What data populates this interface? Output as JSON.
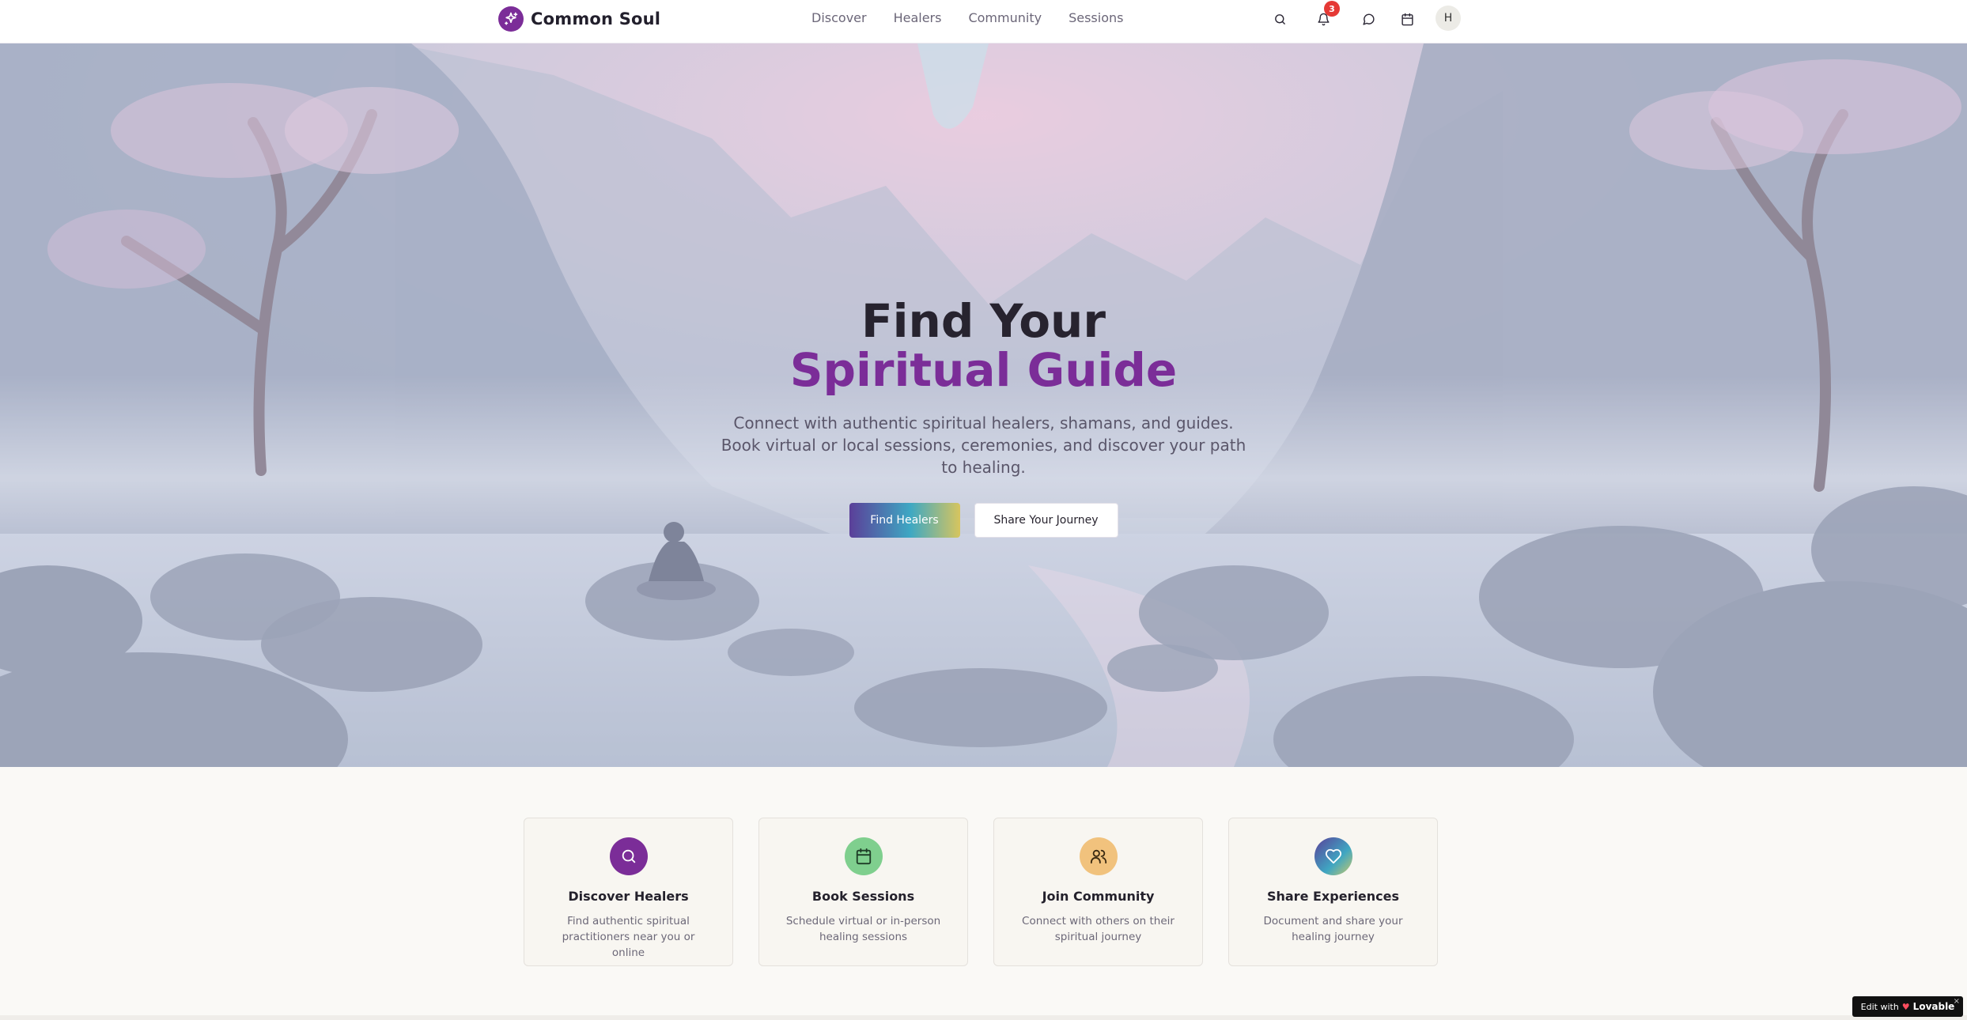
{
  "nav": {
    "logo_text": "Common Soul",
    "links": [
      "Discover",
      "Healers",
      "Community",
      "Sessions"
    ],
    "notification_count": "3",
    "avatar_initial": "H",
    "icons": [
      "search-icon",
      "bell-icon",
      "message-icon",
      "calendar-icon"
    ]
  },
  "hero": {
    "title_line1": "Find Your",
    "title_line2": "Spiritual Guide",
    "subtitle": "Connect with authentic spiritual healers, shamans, and guides. Book virtual or local sessions, ceremonies, and discover your path to healing.",
    "primary_button": "Find Healers",
    "secondary_button": "Share Your Journey"
  },
  "features": [
    {
      "title": "Discover Healers",
      "desc": "Find authentic spiritual practitioners near you or online",
      "icon": "search-icon",
      "color": "#7b2d98"
    },
    {
      "title": "Book Sessions",
      "desc": "Schedule virtual or in-person healing sessions",
      "icon": "calendar-icon",
      "color": "#7fcf8e"
    },
    {
      "title": "Join Community",
      "desc": "Connect with others on their spiritual journey",
      "icon": "users-icon",
      "color": "#f1c27d"
    },
    {
      "title": "Share Experiences",
      "desc": "Document and share your healing journey",
      "icon": "heart-icon",
      "color": "#3f9ac0"
    }
  ],
  "badge": {
    "prefix": "Edit with",
    "brand": "Lovable",
    "close": "×"
  },
  "colors": {
    "brand": "#7b2d98",
    "text": "#27232f",
    "muted": "#6b6678"
  }
}
